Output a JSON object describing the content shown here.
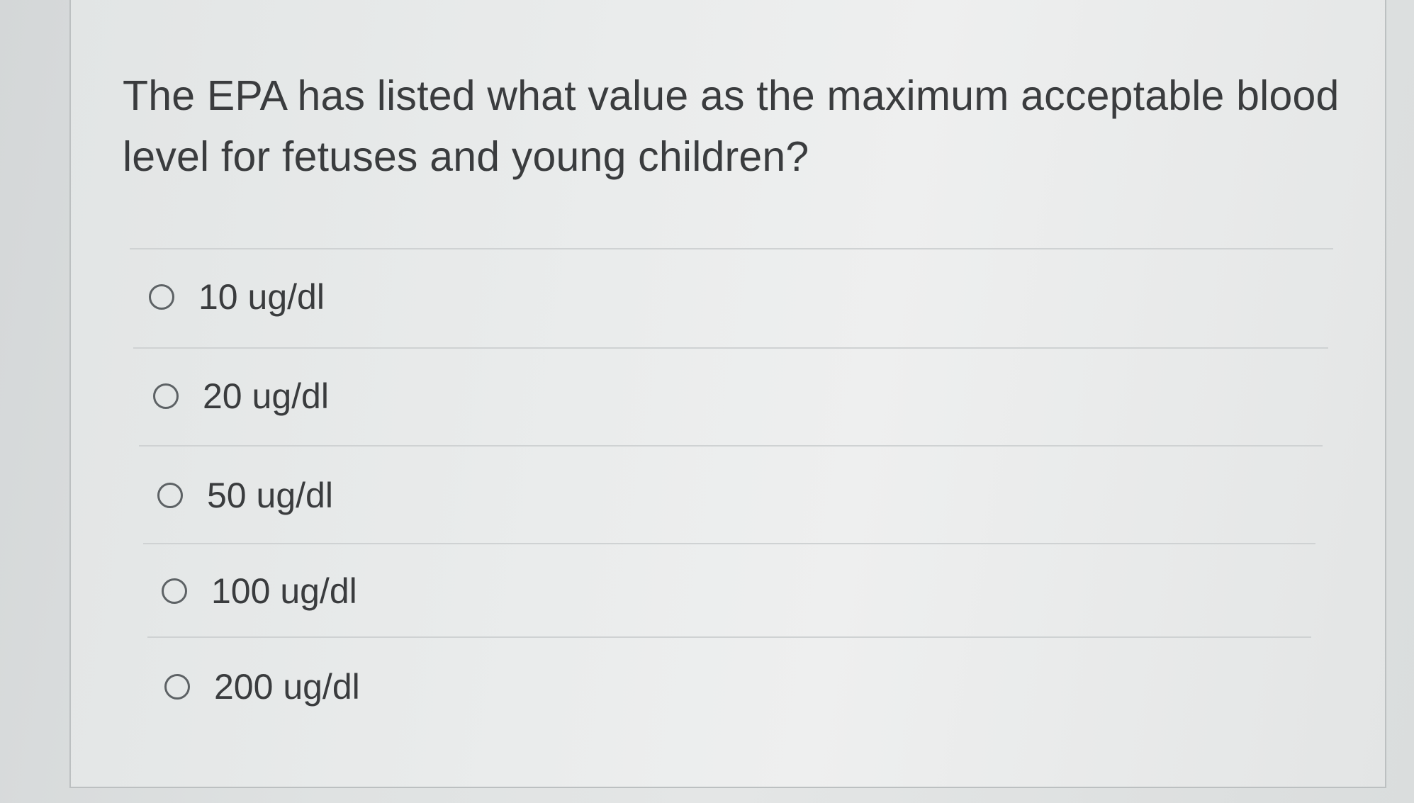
{
  "question": {
    "text": "The EPA has listed what value as the maximum acceptable blood level for fetuses and young children?"
  },
  "options": [
    {
      "label": "10 ug/dl",
      "selected": false
    },
    {
      "label": "20 ug/dl",
      "selected": false
    },
    {
      "label": "50 ug/dl",
      "selected": false
    },
    {
      "label": "100 ug/dl",
      "selected": false
    },
    {
      "label": "200 ug/dl",
      "selected": false
    }
  ]
}
